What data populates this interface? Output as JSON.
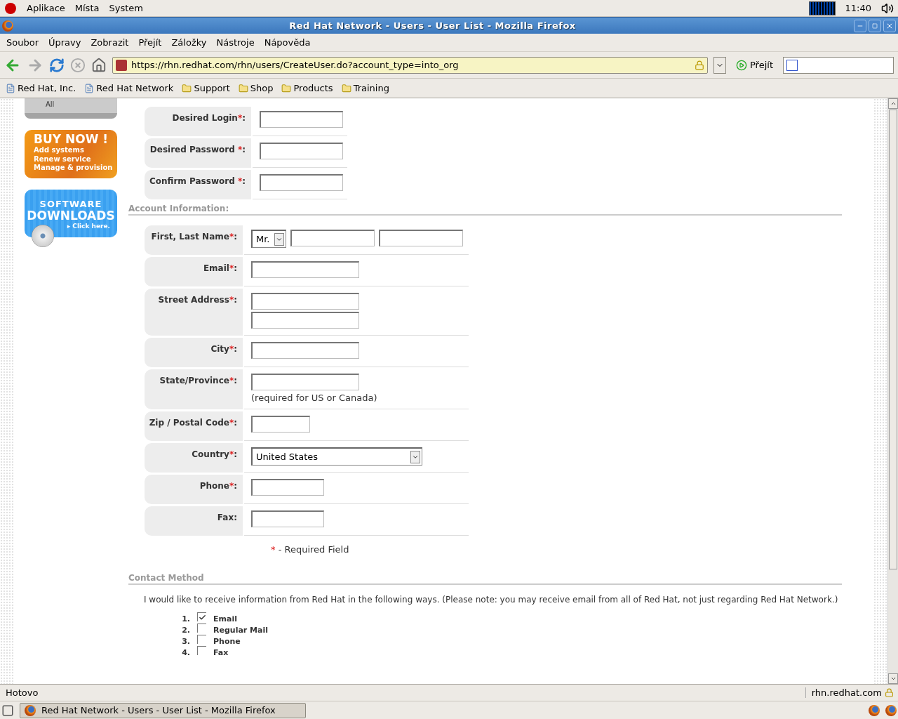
{
  "panel": {
    "menus": [
      "Aplikace",
      "Místa",
      "System"
    ],
    "clock": "11:40"
  },
  "window": {
    "title": "Red Hat Network - Users - User List - Mozilla Firefox"
  },
  "menubar": [
    "Soubor",
    "Úpravy",
    "Zobrazit",
    "Přejít",
    "Záložky",
    "Nástroje",
    "Nápověda"
  ],
  "toolbar": {
    "url": "https://rhn.redhat.com/rhn/users/CreateUser.do?account_type=into_org",
    "go": "Přejít"
  },
  "bookmarks": [
    {
      "label": "Red Hat, Inc.",
      "kind": "page"
    },
    {
      "label": "Red Hat Network",
      "kind": "page"
    },
    {
      "label": "Support",
      "kind": "folder"
    },
    {
      "label": "Shop",
      "kind": "folder"
    },
    {
      "label": "Products",
      "kind": "folder"
    },
    {
      "label": "Training",
      "kind": "folder"
    }
  ],
  "sidebar": {
    "tab": "All",
    "buy_now": {
      "title": "BUY NOW !",
      "lines": [
        "Add systems",
        "Renew service",
        "Manage & provision"
      ]
    },
    "downloads": {
      "line1": "SOFTWARE",
      "line2": "DOWNLOADS",
      "link": "▸ Click here."
    }
  },
  "login_fields": [
    {
      "label": "Desired Login",
      "mark": "*",
      "suffix": ":"
    },
    {
      "label": "Desired Password ",
      "mark": "*",
      "suffix": ":"
    },
    {
      "label": "Confirm Password ",
      "mark": "*",
      "suffix": ":"
    }
  ],
  "account_section": "Account Information:",
  "account_fields": [
    {
      "kind": "name",
      "label": "First, Last Name",
      "mark": "*",
      "suffix": ":",
      "value": "Mr."
    },
    {
      "kind": "text",
      "label": "Email",
      "mark": "*",
      "suffix": ":"
    },
    {
      "kind": "address",
      "label": "Street Address",
      "mark": "*",
      "suffix": ":"
    },
    {
      "kind": "text",
      "label": "City",
      "mark": "*",
      "suffix": ":"
    },
    {
      "kind": "state",
      "label": "State/Province",
      "mark": "*",
      "suffix": ":",
      "note": "(required for US or Canada)"
    },
    {
      "kind": "short",
      "label": "Zip / Postal Code",
      "mark": "*",
      "suffix": ":"
    },
    {
      "kind": "select",
      "label": "Country",
      "mark": "*",
      "suffix": ":",
      "value": "United States"
    },
    {
      "kind": "medium",
      "label": "Phone",
      "mark": "*",
      "suffix": ":"
    },
    {
      "kind": "medium",
      "label": "Fax",
      "suffix": ":"
    }
  ],
  "required_note": {
    "mark": "*",
    "text": "- Required Field"
  },
  "contact": {
    "title": "Contact Method",
    "intro": "I would like to receive information from Red Hat in the following ways. (Please note: you may receive email from all of Red Hat, not just regarding Red Hat Network.)",
    "options": [
      {
        "number": "1.",
        "label": "Email",
        "checked": true
      },
      {
        "number": "2.",
        "label": "Regular Mail",
        "checked": false
      },
      {
        "number": "3.",
        "label": "Phone",
        "checked": false
      },
      {
        "number": "4.",
        "label": "Fax",
        "checked": false
      }
    ]
  },
  "status_bar": {
    "text": "Hotovo",
    "host": "rhn.redhat.com"
  },
  "taskbar": {
    "task": "Red Hat Network - Users - User List - Mozilla Firefox"
  }
}
